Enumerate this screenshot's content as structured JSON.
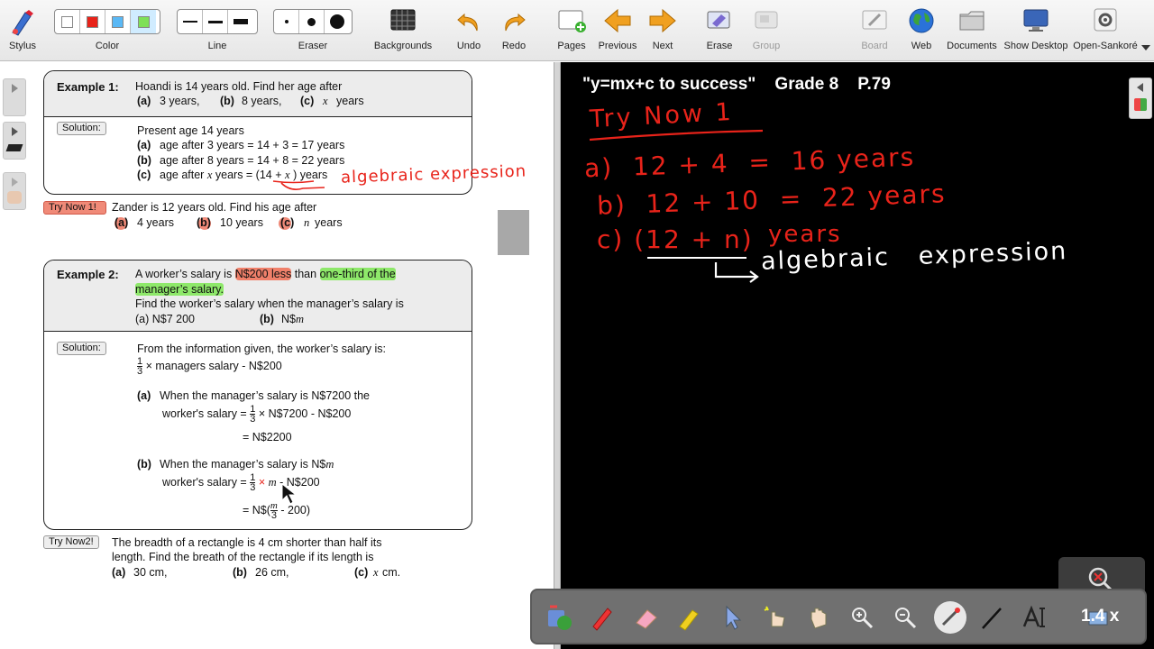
{
  "toolbar": {
    "stylus": "Stylus",
    "color": "Color",
    "line": "Line",
    "eraser": "Eraser",
    "backgrounds": "Backgrounds",
    "undo": "Undo",
    "redo": "Redo",
    "pages": "Pages",
    "previous": "Previous",
    "next": "Next",
    "erase": "Erase",
    "group": "Group",
    "board": "Board",
    "web": "Web",
    "documents": "Documents",
    "show_desktop": "Show Desktop",
    "open_sankore": "Open-Sankoré",
    "colors": [
      "#ffffff",
      "#e8231a",
      "#5ab8f5",
      "#7ee058"
    ]
  },
  "example1": {
    "label": "Example 1:",
    "question": "Hoandi is 14 years old.  Find her age after",
    "opt_a_label": "(a)",
    "opt_a": "3 years,",
    "opt_b_label": "(b)",
    "opt_b": "8 years,",
    "opt_c_label": "(c)",
    "opt_c_var": "x",
    "opt_c": "years",
    "solution_tag": "Solution:",
    "line0": "Present age 14 years",
    "line_a_label": "(a)",
    "line_a": "age after 3 years = 14 + 3 = 17 years",
    "line_b_label": "(b)",
    "line_b": "age after 8 years = 14 + 8 = 22 years",
    "line_c_label": "(c)",
    "line_c_pre": "age after",
    "line_c_var": "x",
    "line_c_mid": "years = (14 +",
    "line_c_var2": "x",
    "line_c_post": ") years"
  },
  "doc_annotation": "algebraic expression",
  "trynow1": {
    "tag": "Try Now 1!",
    "question": "Zander is 12 years old.  Find his age after",
    "a_label": "(a)",
    "a": "4 years",
    "b_label": "(b)",
    "b": "10 years",
    "c_label": "(c)",
    "c_var": "n",
    "c": "years"
  },
  "example2": {
    "label": "Example 2:",
    "q_part1": "A worker’s salary is",
    "q_highlight_red": "N$200 less",
    "q_part2": "than",
    "q_highlight_green1": "one-third of the",
    "q_highlight_green2": "manager’s salary.",
    "q_line2": "Find the worker’s salary when the manager’s  salary is",
    "opt_a": "(a) N$7 200",
    "opt_b_label": "(b)",
    "opt_b": "N$",
    "opt_b_var": "m",
    "solution_tag": "Solution:",
    "s_intro": "From the information given, the worker’s salary is:",
    "frac_num": "1",
    "frac_den": "3",
    "s_formula": "× managers salary - N$200",
    "s_a_label": "(a)",
    "s_a_text": "When the manager’s salary is N$7200 the",
    "s_a_ws": "worker's salary =",
    "s_a_expr": "× N$7200 - N$200",
    "s_a_result": "= N$2200",
    "s_b_label": "(b)",
    "s_b_text": "When the manager’s salary is N$",
    "s_b_var": "m",
    "s_b_ws": "worker's salary =",
    "s_b_times": "×",
    "s_b_expr": "- N$200",
    "s_b_result_pre": "= N$(",
    "s_b_result_post": "- 200)"
  },
  "trynow2": {
    "tag": "Try Now2!",
    "line1": "The breadth of a rectangle is 4 cm shorter than half its",
    "line2": "length.  Find the breath of the rectangle if its length is",
    "a_label": "(a)",
    "a": "30 cm,",
    "b_label": "(b)",
    "b": "26 cm,",
    "c_label": "(c)",
    "c_var": "x",
    "c": "cm."
  },
  "board": {
    "title": "\"y=mx+c to success\"    Grade 8    P.79",
    "heading": "Try Now 1",
    "line_a": "a)  12 + 4  =  16 years",
    "line_b": "b)  12 + 10  =  22 years",
    "line_c_paren": "c) (12 + n)",
    "line_c_years": "years",
    "annotation": "algebraic   expression"
  },
  "zoom": {
    "value": "1.4 x"
  }
}
